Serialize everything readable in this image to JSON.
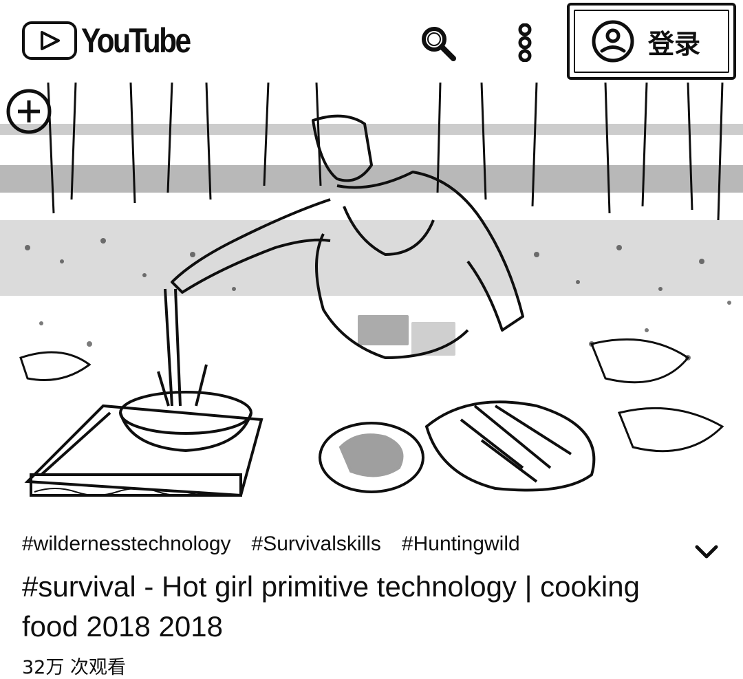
{
  "header": {
    "logo_text": "YouTube",
    "search_icon": "search-icon",
    "more_icon": "more-vertical-icon",
    "signin_icon": "account-circle-icon",
    "signin_label": "登录"
  },
  "video": {
    "thumbnail_description": "outdoor cooking scene",
    "watermark_icon": "channel-watermark-icon"
  },
  "details": {
    "hashtags": [
      "#wildernesstechnology",
      "#Survivalskills",
      "#Huntingwild"
    ],
    "title": "#survival - Hot girl primitive technology | cooking food 2018 2018",
    "views": "32万 次观看",
    "expand_icon": "chevron-down-icon"
  },
  "colors": {
    "text": "#0f0f0f",
    "background": "#ffffff"
  }
}
